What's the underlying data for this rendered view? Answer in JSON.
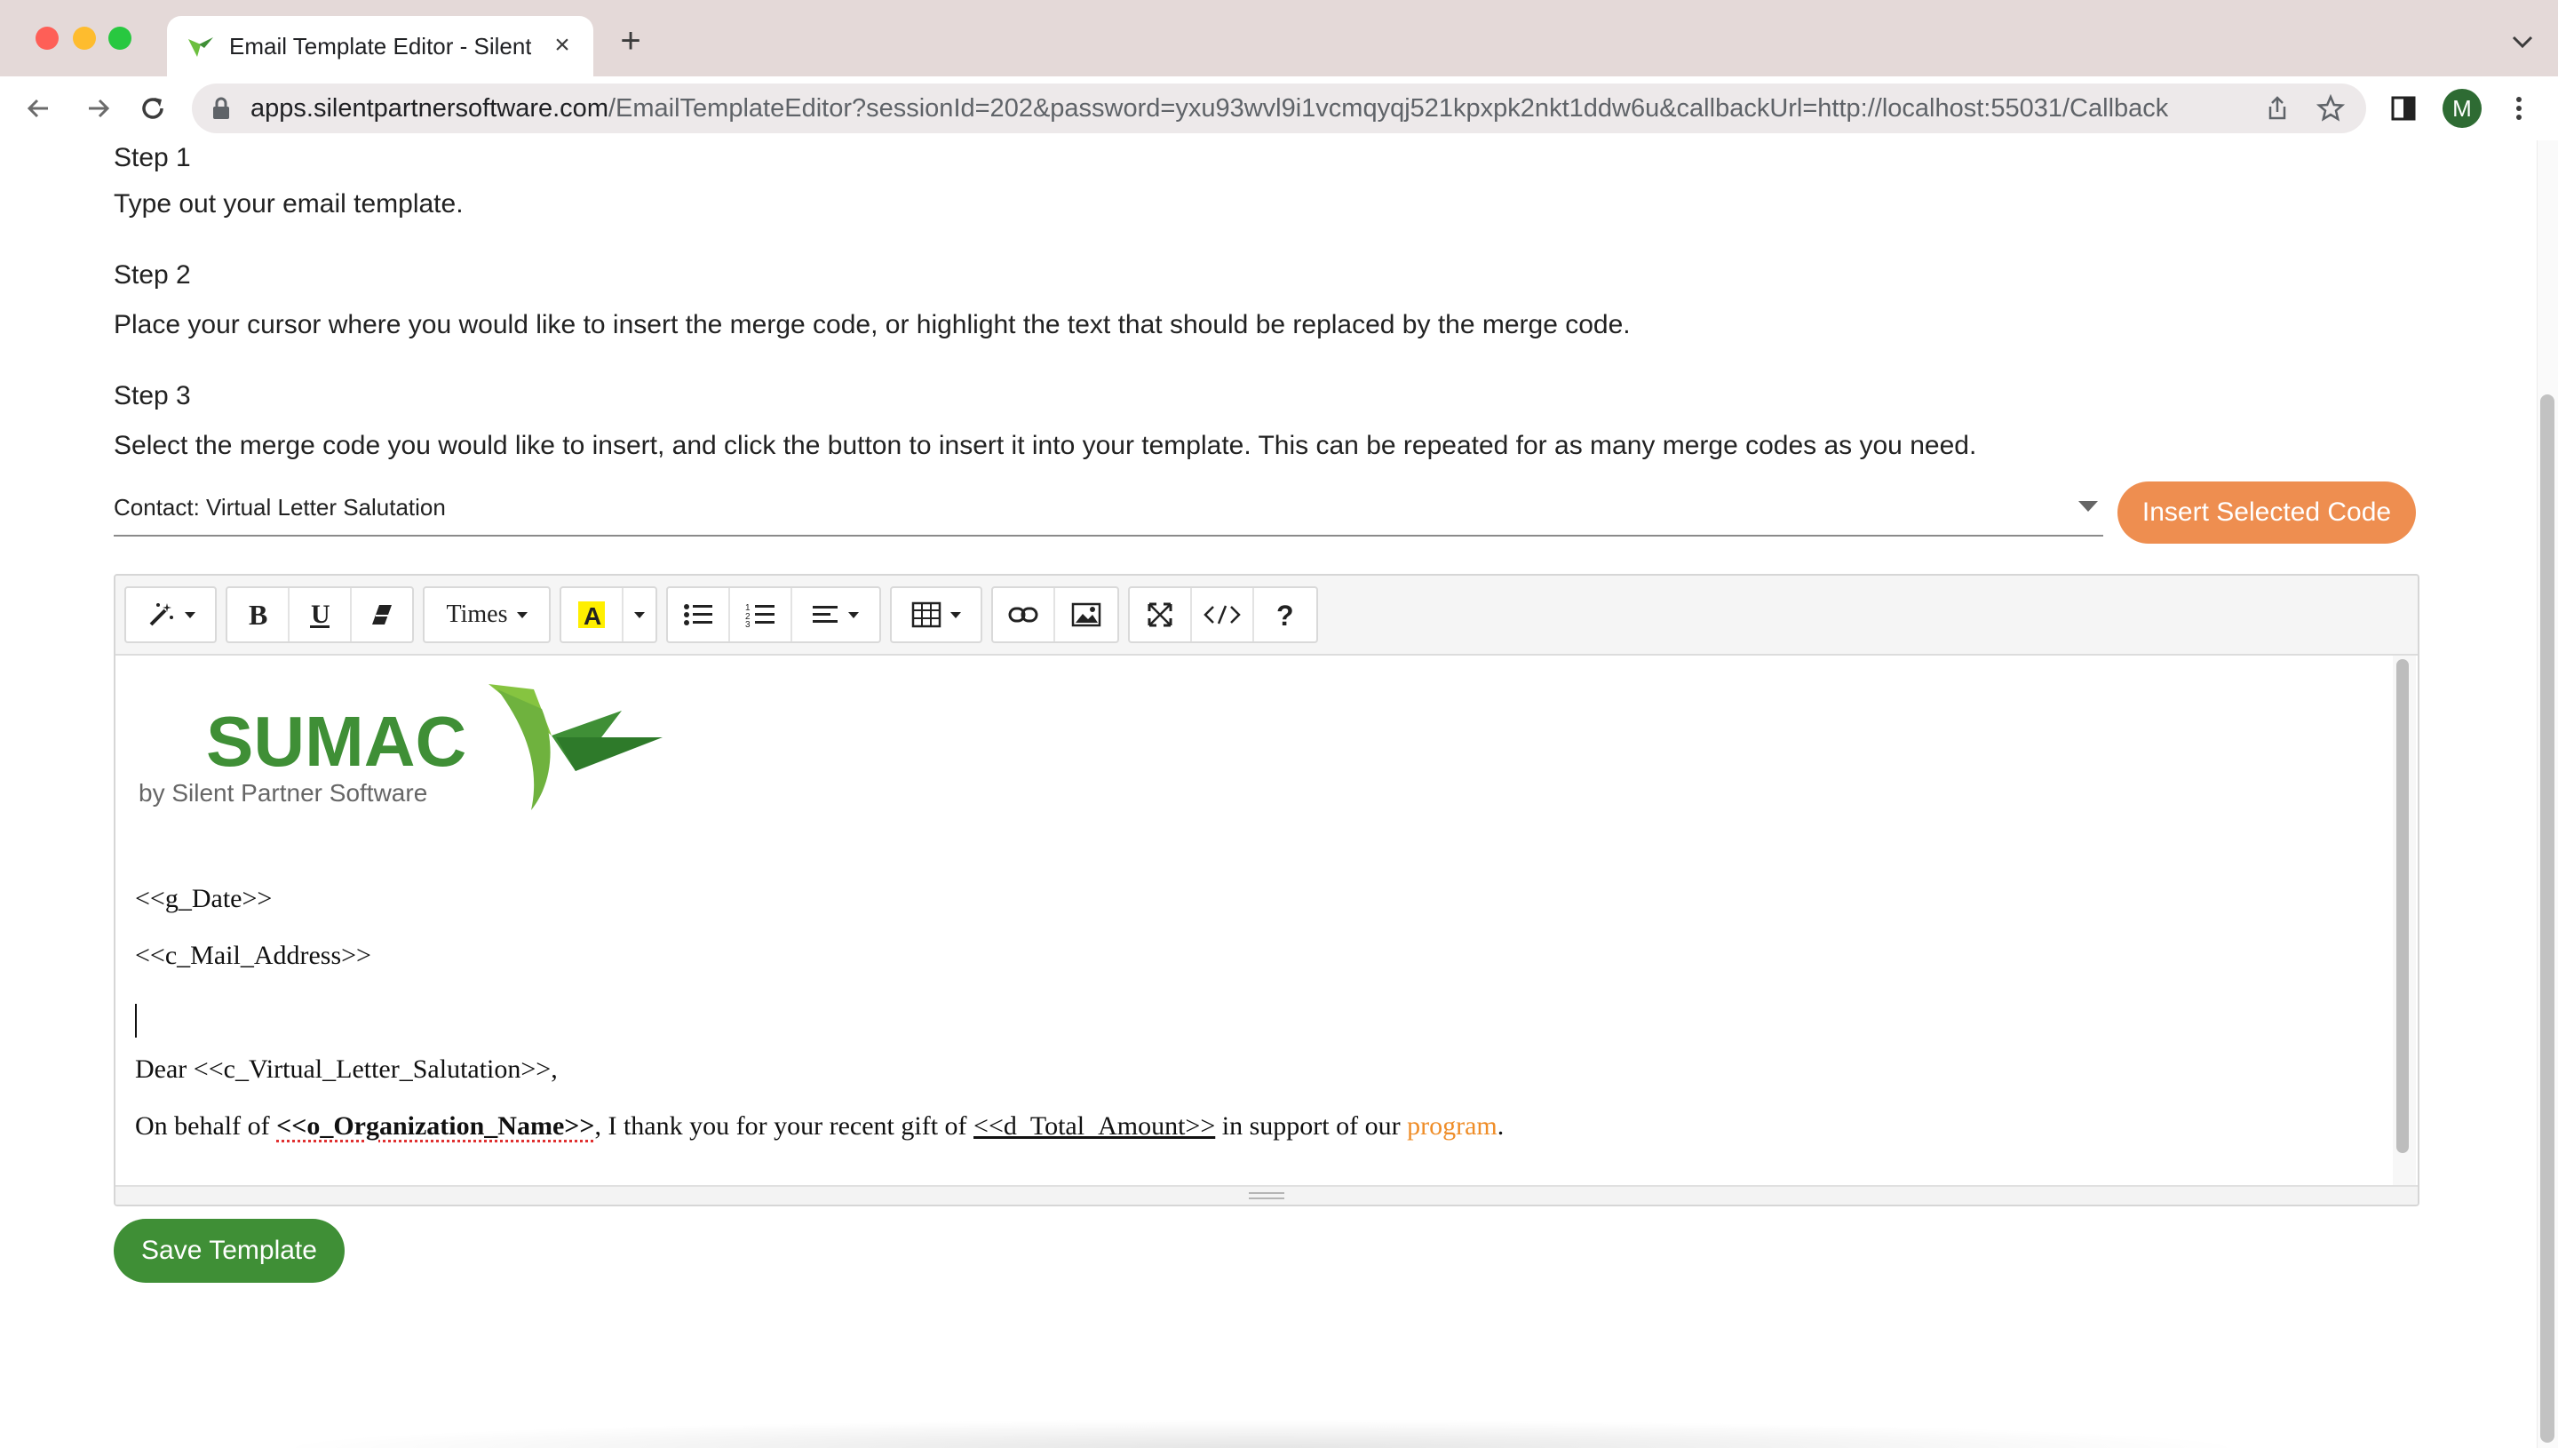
{
  "browser": {
    "tab_title": "Email Template Editor - Silent Partner",
    "url_host": "apps.silentpartnersoftware.com",
    "url_path": "/EmailTemplateEditor?sessionId=202&password=yxu93wvl9i1vcmqyqj521kpxpk2nkt1ddw6u&callbackUrl=http://localhost:55031/Callback",
    "profile_initial": "M"
  },
  "steps": [
    {
      "label": "Step 1",
      "text": "Type out your email template."
    },
    {
      "label": "Step 2",
      "text": "Place your cursor where you would like to insert the merge code, or highlight the text that should be replaced by the merge code."
    },
    {
      "label": "Step 3",
      "text": "Select the merge code you would like to insert, and click the button to insert it into your template. This can be repeated for as many merge codes as you need."
    }
  ],
  "merge_select": {
    "selected": "Contact: Virtual Letter Salutation"
  },
  "insert_button": "Insert Selected Code",
  "editor": {
    "font_name": "Times",
    "logo": {
      "title": "SUMAC",
      "subtitle": "by Silent Partner Software"
    },
    "lines": {
      "date": "<<g_Date>>",
      "address": "<<c_Mail_Address>>",
      "salutation": "Dear <<c_Virtual_Letter_Salutation>>,",
      "body_1": "On behalf of ",
      "org_name": "<<o_Organization_Name>>",
      "body_2": ", I thank you for your recent gift of ",
      "total_amount": "<<d_Total_Amount>>",
      "body_3": " in support of our ",
      "program_word": "program",
      "body_4": "."
    }
  },
  "save_button": "Save Template",
  "colors": {
    "insert_button": "#ee8e50",
    "save_button": "#3f8f36",
    "logo_green": "#3f8f36",
    "program_text": "#ef8d28"
  }
}
